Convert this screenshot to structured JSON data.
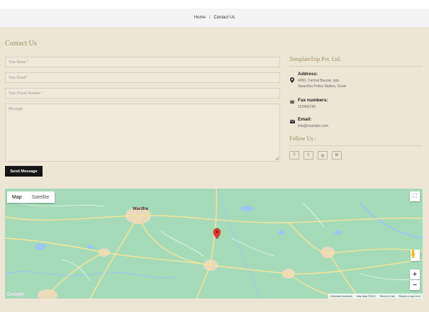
{
  "breadcrumb": {
    "home": "Home",
    "separator": "/",
    "current": "Contact Us"
  },
  "contact": {
    "title": "Contact Us",
    "name_placeholder": "Your Name *",
    "email_placeholder": "Your Email *",
    "phone_placeholder": "Your Phone Number *",
    "message_placeholder": "Message",
    "send_label": "Send Message"
  },
  "company": {
    "name": "TemplateTrip Pvt. Ltd.",
    "address_title": "Address:",
    "address_line1": "4000, Central Bazzar, opp.",
    "address_line2": "Varachha Police Station, Surat",
    "fax_title": "Fax numbers:",
    "fax_value": "123456789",
    "email_title": "Email:",
    "email_value": "info@example.com",
    "follow_title": "Follow Us :"
  },
  "social": [
    {
      "icon": "facebook-icon",
      "glyph": "f"
    },
    {
      "icon": "twitter-icon",
      "glyph": "t"
    },
    {
      "icon": "instagram-icon",
      "glyph": "◎"
    },
    {
      "icon": "linkedin-icon",
      "glyph": "in"
    }
  ],
  "map": {
    "tab_map": "Map",
    "tab_satellite": "Satellite",
    "city_main": "Wardha",
    "zoom_in": "+",
    "zoom_out": "−",
    "fullscreen": "⛶",
    "google": "Google",
    "attrib_shortcuts": "Keyboard shortcuts",
    "attrib_data": "Map data ©2022",
    "attrib_terms": "Terms of Use",
    "attrib_report": "Report a map error",
    "pin_color": "#e53935"
  },
  "colors": {
    "background": "#ede6d5",
    "accent": "#a08a61",
    "button": "#151515",
    "map_land": "#a6dbb9"
  }
}
